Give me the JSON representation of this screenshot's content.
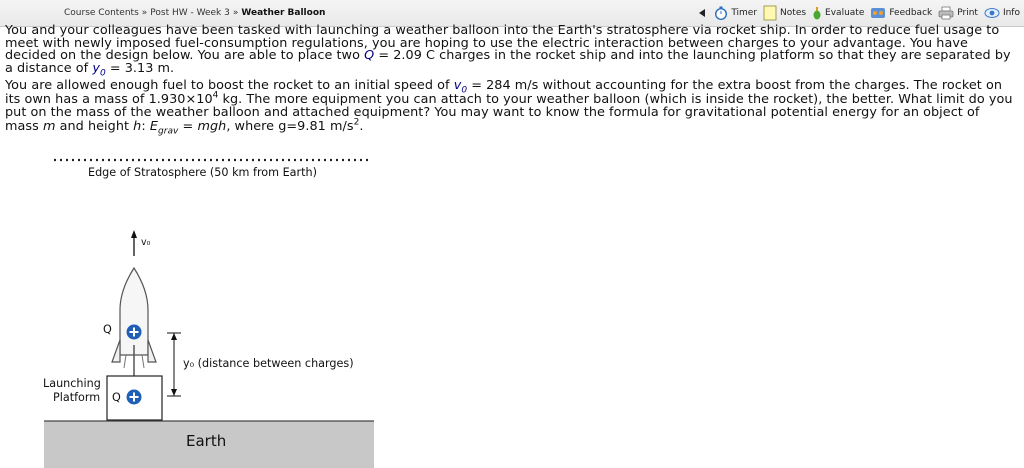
{
  "breadcrumb": {
    "items": [
      "Course Contents",
      "Post HW - Week 3"
    ],
    "separator": "»",
    "current": "Weather Balloon"
  },
  "toolbar": {
    "timer": "Timer",
    "notes": "Notes",
    "evaluate": "Evaluate",
    "feedback": "Feedback",
    "print": "Print",
    "info": "Info"
  },
  "problem": {
    "p1": {
      "a": "You and your colleagues have been tasked with launching a weather balloon into the Earth's stratosphere via rocket ship. In order to reduce fuel usage to meet with newly imposed fuel-consumption regulations, you are hoping to use the electric interaction between charges to your advantage. You have decided on the design below. You are able to place two ",
      "Q": "Q",
      "b": " = 2.09 C charges in the rocket ship and into the launching platform so that they are separated by a distance of ",
      "y": "y",
      "ysub": "0",
      "c": " = 3.13 m."
    },
    "p2": {
      "a": "You are allowed enough fuel to boost the rocket to an initial speed of ",
      "v": "v",
      "vsub": "0",
      "b": " = 284 m/s without accounting for the extra boost from the charges. The rocket on its own has a mass of 1.930×10",
      "exp": "4",
      "c": " kg. The more equipment you can attach to your weather balloon (which is inside the rocket), the better. What limit do you put on the mass of the weather balloon and attached equipment? You may want to know the formula for gravitational potential energy for an object of mass ",
      "m": "m",
      "d": " and height ",
      "h": "h",
      "e": ": ",
      "E": "E",
      "Esub": "grav",
      "f": " = ",
      "mgh": "mgh",
      "g": ", where g=9.81 m/s",
      "gexp": "2",
      "end": "."
    }
  },
  "diagram": {
    "stratosphere": "Edge of Stratosphere (50 km from Earth)",
    "v0_label": "v₀",
    "q_label_top": "Q",
    "q_label_bottom": "Q",
    "charge_symbol": "+",
    "y0_label": "y₀ (distance between charges)",
    "platform_label_line1": "Launching",
    "platform_label_line2": "Platform",
    "earth_label": "Earth"
  },
  "colors": {
    "charge_fill": "#1f5fb5",
    "nav_arrow": "#3aa64a",
    "earth_fill": "#c8c8c8"
  }
}
